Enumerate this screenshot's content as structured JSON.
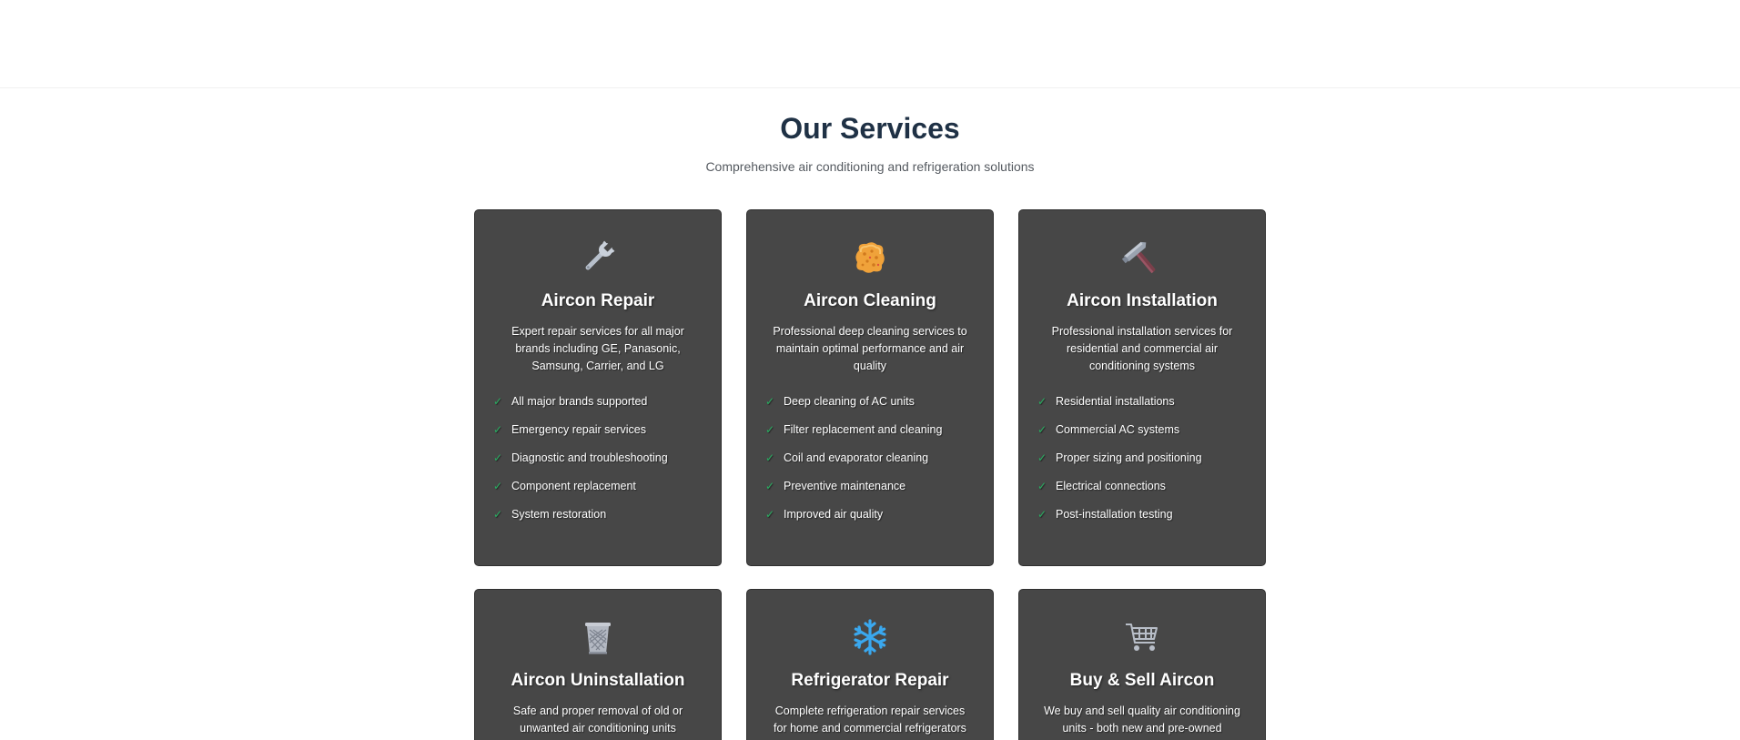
{
  "header": {},
  "services": {
    "title": "Our Services",
    "subtitle": "Comprehensive air conditioning and refrigeration solutions",
    "check_mark": "✓",
    "cards": [
      {
        "icon": "wrench-icon",
        "title": "Aircon Repair",
        "description": "Expert repair services for all major brands including GE, Panasonic, Samsung, Carrier, and LG",
        "features": [
          "All major brands supported",
          "Emergency repair services",
          "Diagnostic and troubleshooting",
          "Component replacement",
          "System restoration"
        ]
      },
      {
        "icon": "sponge-icon",
        "title": "Aircon Cleaning",
        "description": "Professional deep cleaning services to maintain optimal performance and air quality",
        "features": [
          "Deep cleaning of AC units",
          "Filter replacement and cleaning",
          "Coil and evaporator cleaning",
          "Preventive maintenance",
          "Improved air quality"
        ]
      },
      {
        "icon": "hammer-icon",
        "title": "Aircon Installation",
        "description": "Professional installation services for residential and commercial air conditioning systems",
        "features": [
          "Residential installations",
          "Commercial AC systems",
          "Proper sizing and positioning",
          "Electrical connections",
          "Post-installation testing"
        ]
      },
      {
        "icon": "wastebasket-icon",
        "title": "Aircon Uninstallation",
        "description": "Safe and proper removal of old or unwanted air conditioning units",
        "features": []
      },
      {
        "icon": "snowflake-icon",
        "title": "Refrigerator Repair",
        "description": "Complete refrigeration repair services for home and commercial refrigerators",
        "features": []
      },
      {
        "icon": "shopping-cart-icon",
        "title": "Buy & Sell Aircon",
        "description": "We buy and sell quality air conditioning units - both new and pre-owned",
        "features": []
      }
    ]
  },
  "colors": {
    "heading": "#1f3145",
    "card_background": "#474747",
    "check": "#27ae60",
    "text_on_card": "#ffffff"
  }
}
